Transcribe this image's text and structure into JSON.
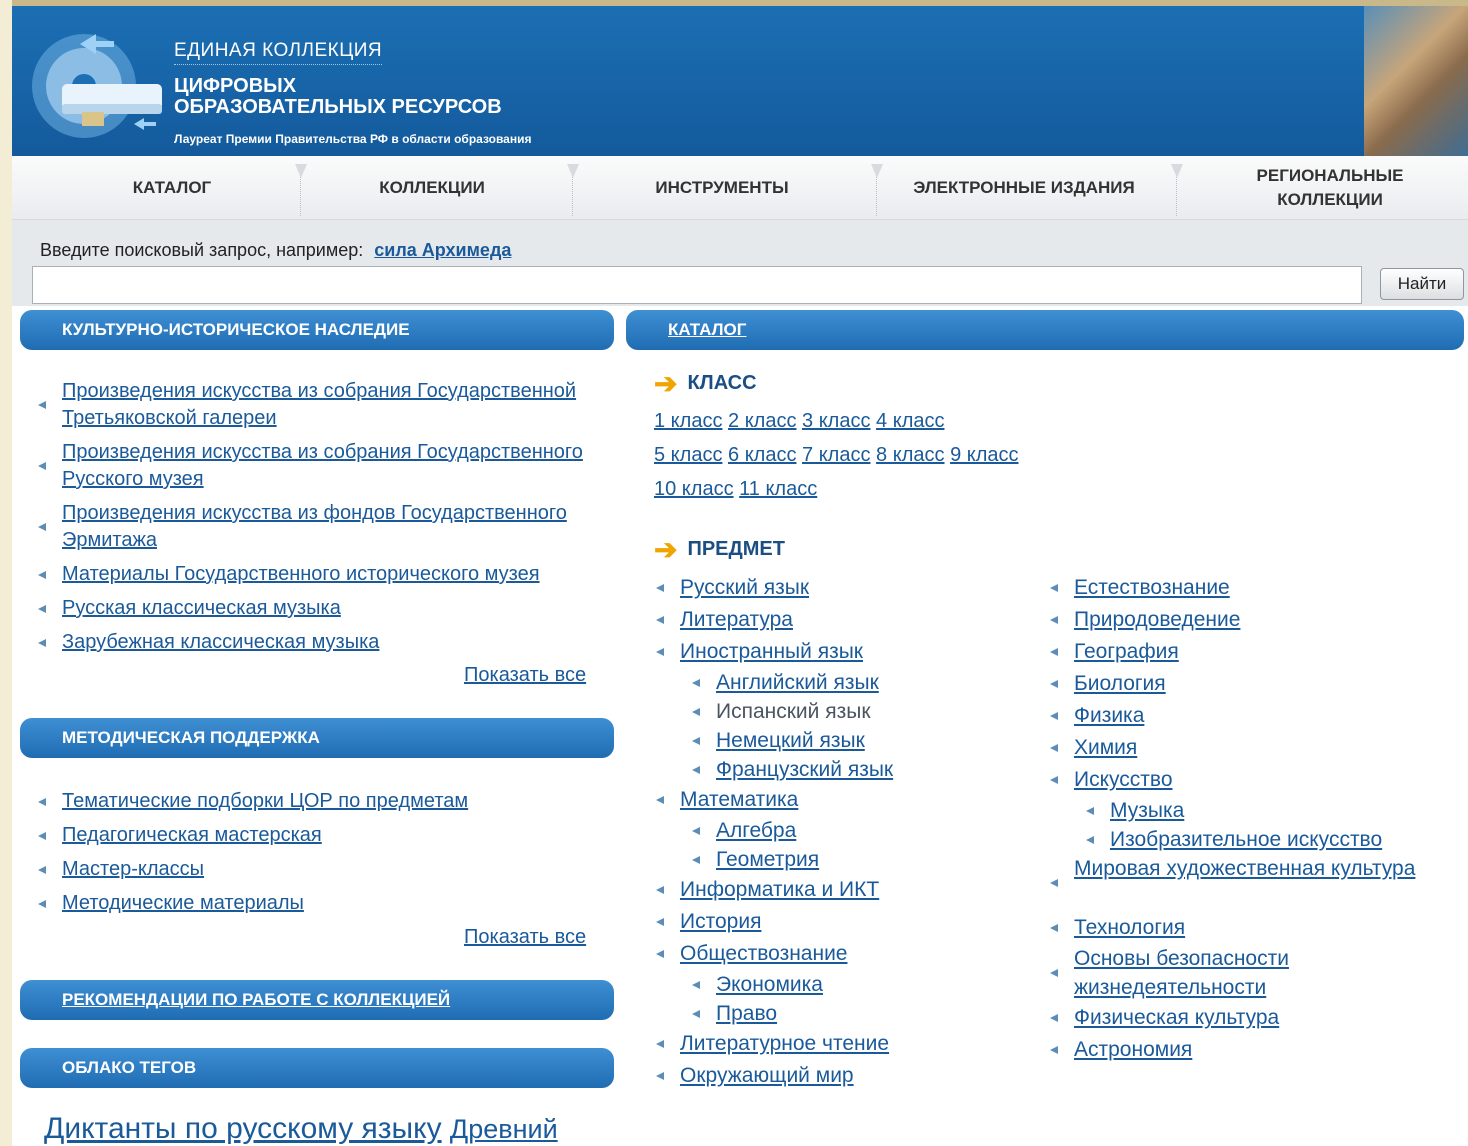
{
  "header": {
    "brand_line1": "ЕДИНАЯ КОЛЛЕКЦИЯ",
    "brand_line2": "ЦИФРОВЫХ",
    "brand_line3": "ОБРАЗОВАТЕЛЬНЫХ РЕСУРСОВ",
    "tagline": "Лауреат Премии Правительства РФ в области образования"
  },
  "nav": [
    "КАТАЛОГ",
    "КОЛЛЕКЦИИ",
    "ИНСТРУМЕНТЫ",
    "ЭЛЕКТРОННЫЕ ИЗДАНИЯ",
    "РЕГИОНАЛЬНЫЕ КОЛЛЕКЦИИ"
  ],
  "search": {
    "prompt": "Введите поисковый запрос, например:",
    "example": "сила Архимеда",
    "value": "",
    "button": "Найти"
  },
  "left": {
    "heritage": {
      "title": "КУЛЬТУРНО-ИСТОРИЧЕСКОЕ НАСЛЕДИЕ",
      "items": [
        "Произведения искусства из собрания Государственной Третьяковской галереи",
        "Произведения искусства из собрания Государственного Русского музея",
        "Произведения искусства из фондов Государственного Эрмитажа",
        "Материалы Государственного исторического музея",
        "Русская классическая музыка",
        "Зарубежная классическая музыка"
      ],
      "show_all": "Показать все"
    },
    "methods": {
      "title": "МЕТОДИЧЕСКАЯ ПОДДЕРЖКА",
      "items": [
        "Тематические подборки ЦОР по предметам",
        "Педагогическая мастерская",
        "Мастер-классы",
        "Методические материалы"
      ],
      "show_all": "Показать все"
    },
    "recommend_title": "РЕКОМЕНДАЦИИ ПО РАБОТЕ С КОЛЛЕКЦИЕЙ",
    "tags_title": "ОБЛАКО ТЕГОВ",
    "tags": [
      "Диктанты по русскому языку",
      "Древний"
    ]
  },
  "catalog": {
    "title": "КАТАЛОГ",
    "grade_head": "КЛАСС",
    "grades_row1": [
      "1 класс",
      "2 класс",
      "3 класс",
      "4 класс"
    ],
    "grades_row2": [
      "5 класс",
      "6 класс",
      "7 класс",
      "8 класс",
      "9 класс"
    ],
    "grades_row3": [
      "10 класс",
      "11 класс"
    ],
    "subject_head": "ПРЕДМЕТ",
    "subjects_left": [
      {
        "label": "Русский язык",
        "sub": false,
        "link": true
      },
      {
        "label": "Литература",
        "sub": false,
        "link": true
      },
      {
        "label": "Иностранный язык",
        "sub": false,
        "link": true
      },
      {
        "label": "Английский язык",
        "sub": true,
        "link": true
      },
      {
        "label": "Испанский язык",
        "sub": true,
        "link": false
      },
      {
        "label": "Немецкий язык",
        "sub": true,
        "link": true
      },
      {
        "label": "Французский язык",
        "sub": true,
        "link": true
      },
      {
        "label": "Математика",
        "sub": false,
        "link": true
      },
      {
        "label": "Алгебра",
        "sub": true,
        "link": true
      },
      {
        "label": "Геометрия",
        "sub": true,
        "link": true
      },
      {
        "label": "Информатика и ИКТ",
        "sub": false,
        "link": true
      },
      {
        "label": "История",
        "sub": false,
        "link": true
      },
      {
        "label": "Обществознание",
        "sub": false,
        "link": true
      },
      {
        "label": "Экономика",
        "sub": true,
        "link": true
      },
      {
        "label": "Право",
        "sub": true,
        "link": true
      },
      {
        "label": "Литературное чтение",
        "sub": false,
        "link": true
      },
      {
        "label": "Окружающий мир",
        "sub": false,
        "link": true
      }
    ],
    "subjects_right": [
      {
        "label": "Естествознание",
        "sub": false,
        "link": true
      },
      {
        "label": "Природоведение",
        "sub": false,
        "link": true
      },
      {
        "label": "География",
        "sub": false,
        "link": true
      },
      {
        "label": "Биология",
        "sub": false,
        "link": true
      },
      {
        "label": "Физика",
        "sub": false,
        "link": true
      },
      {
        "label": "Химия",
        "sub": false,
        "link": true
      },
      {
        "label": "Искусство",
        "sub": false,
        "link": true
      },
      {
        "label": "Музыка",
        "sub": true,
        "link": true
      },
      {
        "label": "Изобразительное искусство",
        "sub": true,
        "link": true
      },
      {
        "label": "Мировая художественная культура",
        "sub": false,
        "link": true,
        "tall": true
      },
      {
        "label": "Технология",
        "sub": false,
        "link": true
      },
      {
        "label": "Основы безопасности жизнедеятельности",
        "sub": false,
        "link": true,
        "tall": true
      },
      {
        "label": "Физическая культура",
        "sub": false,
        "link": true
      },
      {
        "label": "Астрономия",
        "sub": false,
        "link": true
      }
    ]
  }
}
